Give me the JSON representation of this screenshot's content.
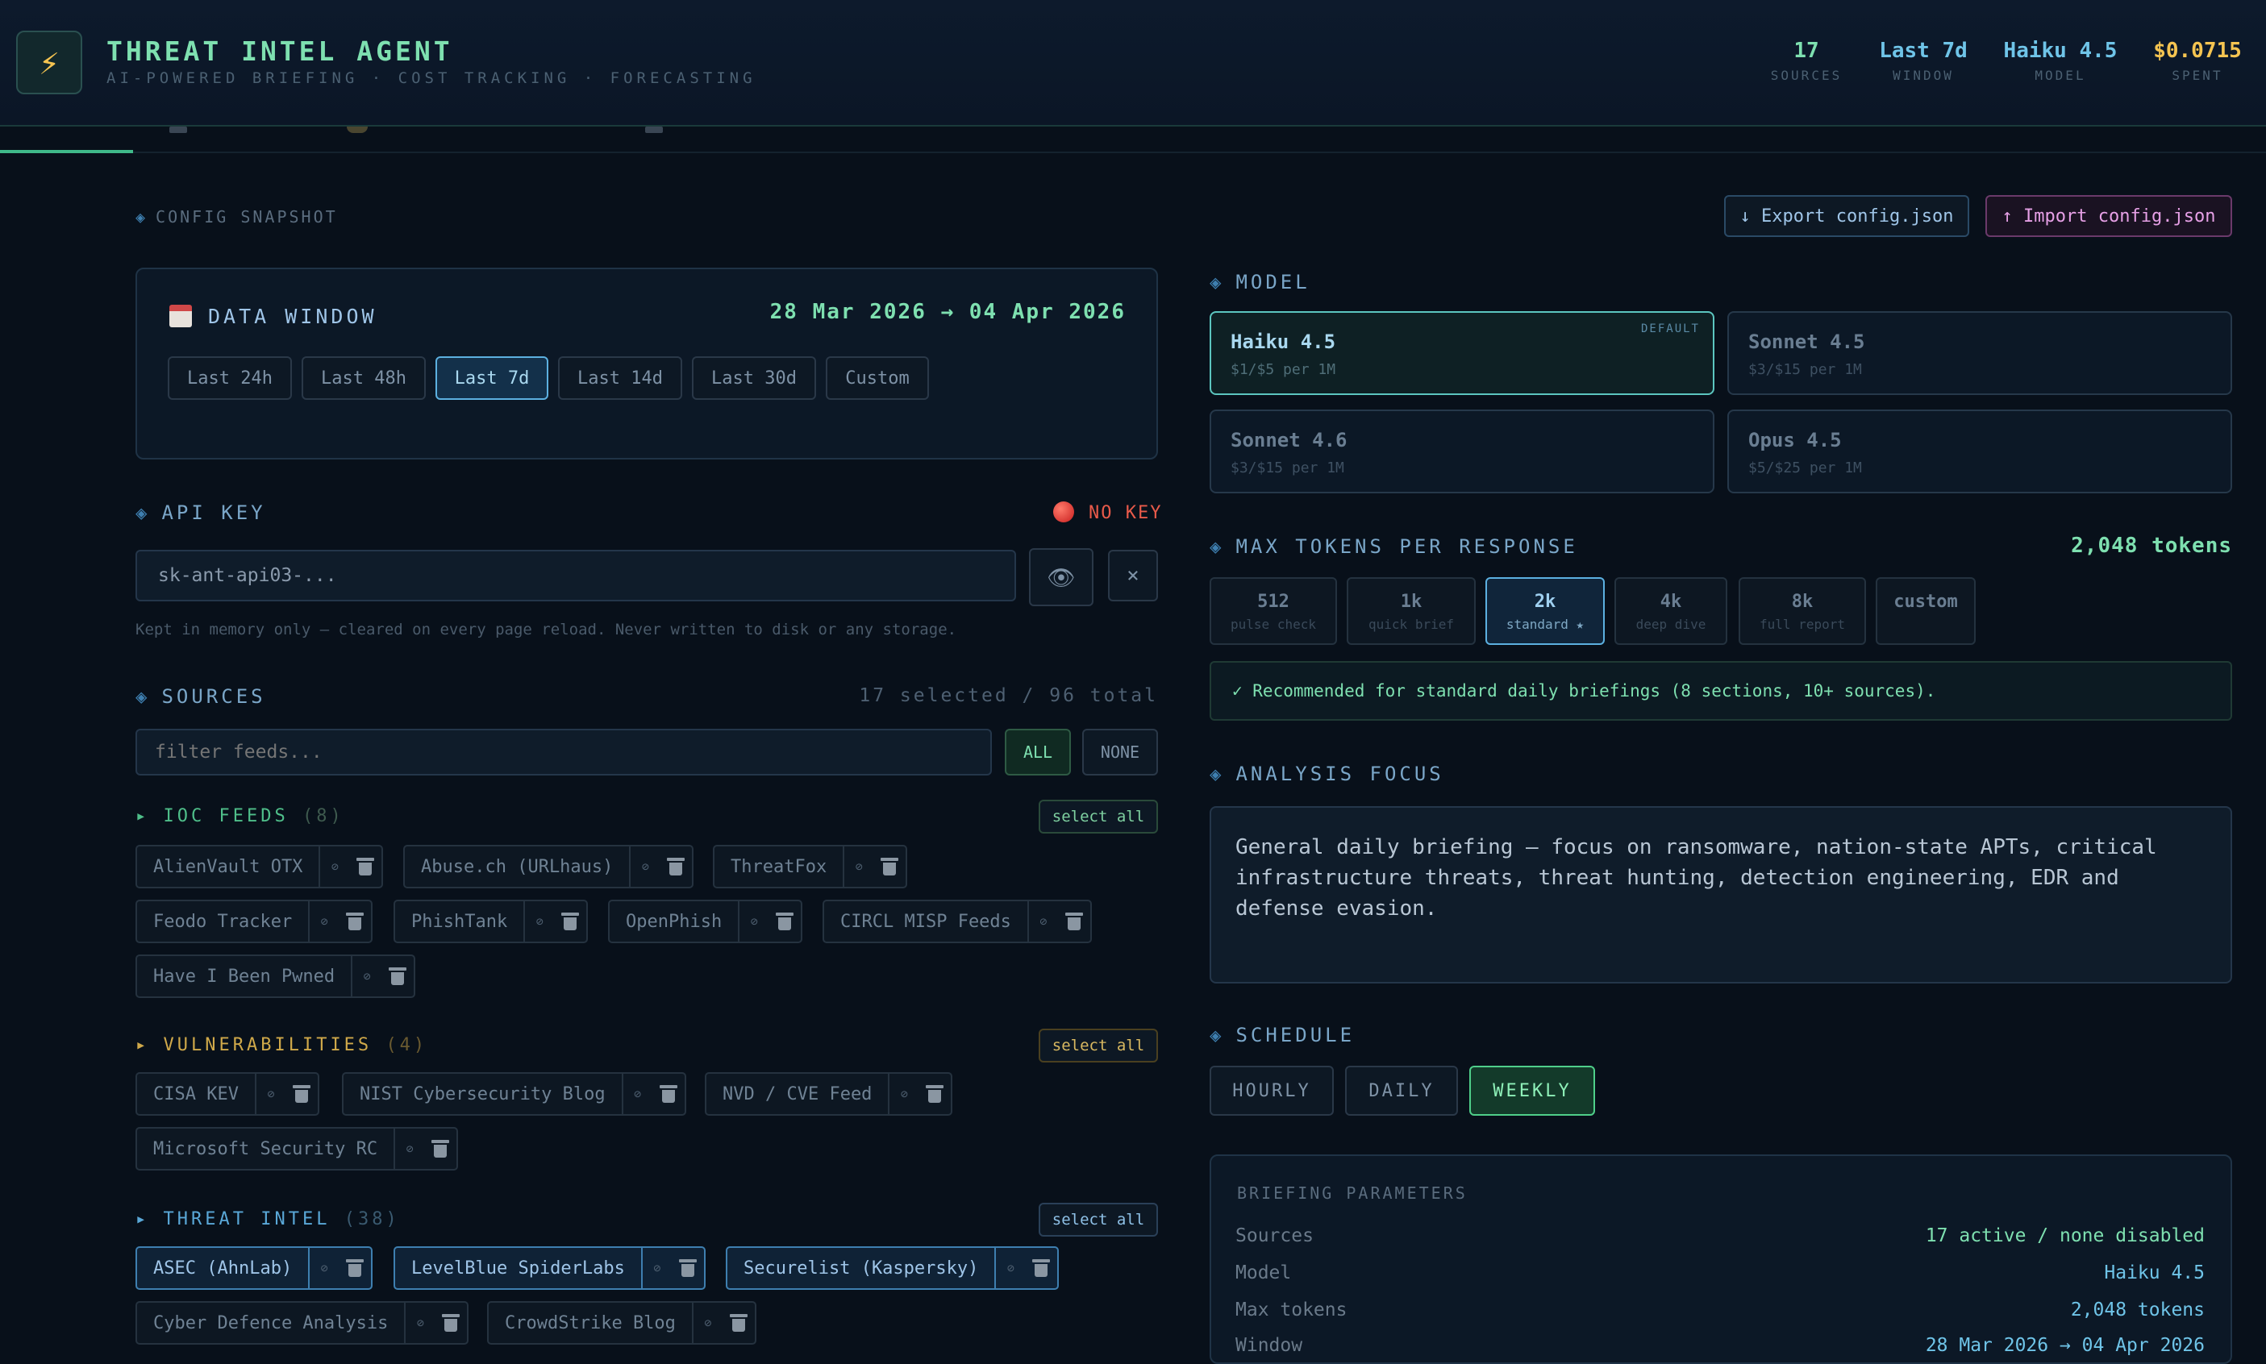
{
  "header": {
    "logo_glyph": "⚡",
    "title": "THREAT INTEL AGENT",
    "subtitle": "AI-POWERED BRIEFING · COST TRACKING · FORECASTING",
    "stats": [
      {
        "value": "17",
        "label": "SOURCES",
        "color": "#7ee0b0"
      },
      {
        "value": "Last 7d",
        "label": "WINDOW",
        "color": "#6fc4e8"
      },
      {
        "value": "Haiku 4.5",
        "label": "MODEL",
        "color": "#6fc4e8"
      },
      {
        "value": "$0.0715",
        "label": "SPENT",
        "color": "#f5c451"
      }
    ]
  },
  "config": {
    "label": "CONFIG SNAPSHOT",
    "export_label": "↓ Export config.json",
    "import_label": "↑ Import config.json"
  },
  "data_window": {
    "title": "DATA WINDOW",
    "range": "28 Mar 2026 → 04 Apr 2026",
    "options": [
      "Last 24h",
      "Last 48h",
      "Last 7d",
      "Last 14d",
      "Last 30d",
      "Custom"
    ],
    "selected": "Last 7d"
  },
  "api_key": {
    "title": "API KEY",
    "status": "NO KEY",
    "value": "sk-ant-api03-...",
    "note": "Kept in memory only — cleared on every page reload. Never written to disk or any storage.",
    "show_icon": "👁",
    "clear_label": "×"
  },
  "sources": {
    "title": "SOURCES",
    "count_text": "17 selected / 96 total",
    "filter_placeholder": "filter feeds...",
    "all_label": "ALL",
    "none_label": "NONE",
    "select_all_label": "select all",
    "groups": [
      {
        "name": "IOC FEEDS",
        "count": "(8)",
        "color": "#4fbf8a",
        "items": [
          "AlienVault OTX",
          "Abuse.ch (URLhaus)",
          "ThreatFox",
          "Feodo Tracker",
          "PhishTank",
          "OpenPhish",
          "CIRCL MISP Feeds",
          "Have I Been Pwned"
        ]
      },
      {
        "name": "VULNERABILITIES",
        "count": "(4)",
        "color": "#d0a94a",
        "items": [
          "CISA KEV",
          "NIST Cybersecurity Blog",
          "NVD / CVE Feed",
          "Microsoft Security RC"
        ]
      },
      {
        "name": "THREAT INTEL",
        "count": "(38)",
        "color": "#5aa8d8",
        "items": [
          "ASEC (AhnLab)",
          "LevelBlue SpiderLabs",
          "Securelist (Kaspersky)",
          "Cyber Defence Analysis",
          "CrowdStrike Blog"
        ]
      }
    ]
  },
  "model": {
    "title": "MODEL",
    "default_badge": "DEFAULT",
    "options": [
      {
        "name": "Haiku 4.5",
        "price": "$1/$5 per 1M",
        "active": true
      },
      {
        "name": "Sonnet 4.5",
        "price": "$3/$15 per 1M",
        "active": false
      },
      {
        "name": "Sonnet 4.6",
        "price": "$3/$15 per 1M",
        "active": false
      },
      {
        "name": "Opus 4.5",
        "price": "$5/$25 per 1M",
        "active": false
      }
    ]
  },
  "max_tokens": {
    "title": "MAX TOKENS PER RESPONSE",
    "current": "2,048 tokens",
    "options": [
      {
        "value": "512",
        "desc": "pulse check"
      },
      {
        "value": "1k",
        "desc": "quick brief"
      },
      {
        "value": "2k",
        "desc": "standard ★"
      },
      {
        "value": "4k",
        "desc": "deep dive"
      },
      {
        "value": "8k",
        "desc": "full report"
      },
      {
        "value": "custom",
        "desc": ""
      }
    ],
    "selected": "2k",
    "recommendation": "✓ Recommended for standard daily briefings (8 sections, 10+ sources)."
  },
  "analysis_focus": {
    "title": "ANALYSIS FOCUS",
    "text": "General daily briefing — focus on ransomware, nation-state APTs, critical infrastructure threats, threat hunting, detection engineering, EDR and defense evasion."
  },
  "schedule": {
    "title": "SCHEDULE",
    "options": [
      "HOURLY",
      "DAILY",
      "WEEKLY"
    ],
    "selected": "WEEKLY"
  },
  "briefing_params": {
    "title": "BRIEFING PARAMETERS",
    "rows": [
      {
        "key": "Sources",
        "value": "17 active / none disabled"
      },
      {
        "key": "Model",
        "value": "Haiku 4.5"
      },
      {
        "key": "Max tokens",
        "value": "2,048 tokens"
      },
      {
        "key": "Window",
        "value": "28 Mar 2026 → 04 Apr 2026"
      }
    ]
  }
}
